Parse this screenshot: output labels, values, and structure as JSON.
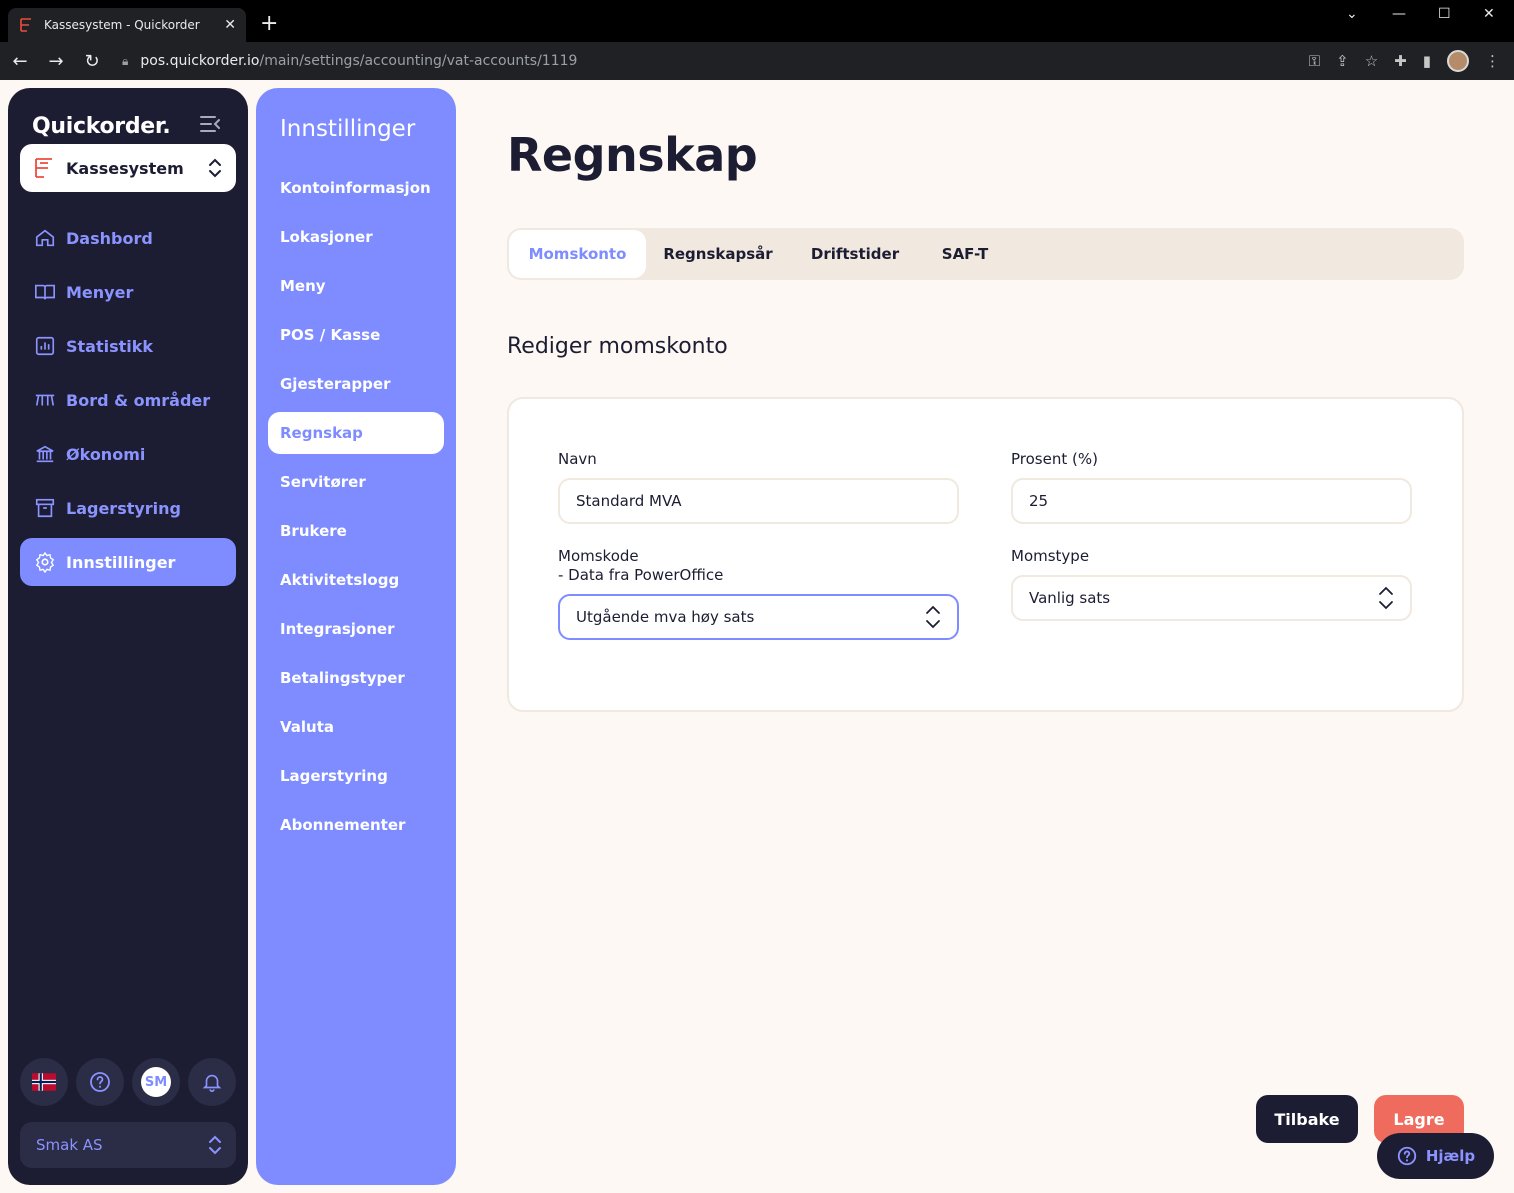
{
  "browser": {
    "tab_title": "Kassesystem - Quickorder",
    "url_host": "pos.quickorder.io",
    "url_path": "/main/settings/accounting/vat-accounts/1119"
  },
  "sidebar": {
    "brand": "Quickorder.",
    "product": "Kassesystem",
    "items": [
      {
        "label": "Dashbord",
        "icon": "home-icon"
      },
      {
        "label": "Menyer",
        "icon": "book-icon"
      },
      {
        "label": "Statistikk",
        "icon": "chart-icon"
      },
      {
        "label": "Bord & områder",
        "icon": "table-icon"
      },
      {
        "label": "Økonomi",
        "icon": "bank-icon"
      },
      {
        "label": "Lagerstyring",
        "icon": "archive-icon"
      },
      {
        "label": "Innstillinger",
        "icon": "gear-icon",
        "active": true
      }
    ],
    "avatar_initials": "SM",
    "organization": "Smak AS"
  },
  "settings_nav": {
    "title": "Innstillinger",
    "items": [
      "Kontoinformasjon",
      "Lokasjoner",
      "Meny",
      "POS / Kasse",
      "Gjesterapper",
      "Regnskap",
      "Servitører",
      "Brukere",
      "Aktivitetslogg",
      "Integrasjoner",
      "Betalingstyper",
      "Valuta",
      "Lagerstyring",
      "Abonnementer"
    ],
    "active_index": 5
  },
  "main": {
    "title": "Regnskap",
    "tabs": [
      "Momskonto",
      "Regnskapsår",
      "Driftstider",
      "SAF-T"
    ],
    "active_tab": 0,
    "section_title": "Rediger momskonto",
    "form": {
      "name_label": "Navn",
      "name_value": "Standard MVA",
      "percent_label": "Prosent (%)",
      "percent_value": "25",
      "vatcode_label": "Momskode",
      "vatcode_sublabel": "- Data fra PowerOffice",
      "vatcode_value": "Utgående mva høy sats",
      "vattype_label": "Momstype",
      "vattype_value": "Vanlig sats"
    }
  },
  "actions": {
    "back": "Tilbake",
    "save": "Lagre",
    "help": "Hjælp"
  },
  "colors": {
    "accent": "#7e8cff",
    "sidebar_bg": "#1c1d33",
    "save": "#ee6b5e",
    "page_bg": "#fdf8f3"
  }
}
